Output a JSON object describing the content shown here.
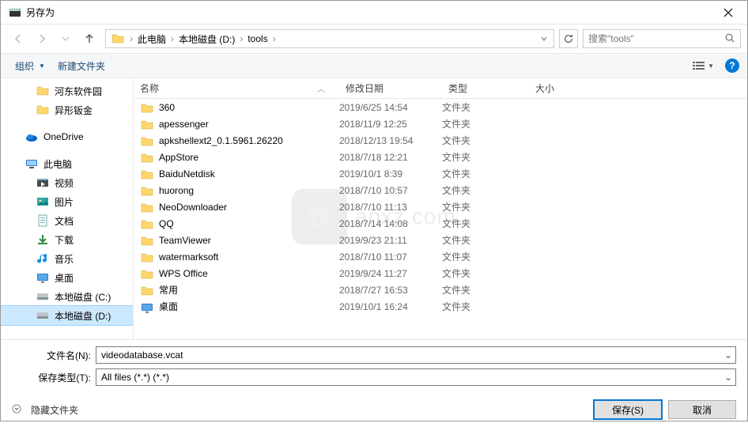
{
  "window": {
    "title": "另存为"
  },
  "nav": {
    "breadcrumbs": [
      "此电脑",
      "本地磁盘 (D:)",
      "tools"
    ],
    "search_placeholder": "搜索\"tools\""
  },
  "toolbar": {
    "organize": "组织",
    "new_folder": "新建文件夹"
  },
  "sidebar": {
    "items": [
      {
        "label": "河东软件园",
        "icon": "folder",
        "lvl": 1
      },
      {
        "label": "异形钣金",
        "icon": "folder",
        "lvl": 1
      },
      {
        "sep": true
      },
      {
        "label": "OneDrive",
        "icon": "onedrive",
        "lvl": 0
      },
      {
        "sep": true
      },
      {
        "label": "此电脑",
        "icon": "pc",
        "lvl": 0
      },
      {
        "label": "视频",
        "icon": "video",
        "lvl": 1
      },
      {
        "label": "图片",
        "icon": "pictures",
        "lvl": 1
      },
      {
        "label": "文档",
        "icon": "documents",
        "lvl": 1
      },
      {
        "label": "下载",
        "icon": "downloads",
        "lvl": 1
      },
      {
        "label": "音乐",
        "icon": "music",
        "lvl": 1
      },
      {
        "label": "桌面",
        "icon": "desktop",
        "lvl": 1
      },
      {
        "label": "本地磁盘 (C:)",
        "icon": "disk",
        "lvl": 1
      },
      {
        "label": "本地磁盘 (D:)",
        "icon": "disk",
        "lvl": 1,
        "selected": true
      }
    ]
  },
  "columns": {
    "name": "名称",
    "date": "修改日期",
    "type": "类型",
    "size": "大小"
  },
  "files": [
    {
      "name": "360",
      "date": "2019/6/25 14:54",
      "type": "文件夹",
      "icon": "folder"
    },
    {
      "name": "apessenger",
      "date": "2018/11/9 12:25",
      "type": "文件夹",
      "icon": "folder"
    },
    {
      "name": "apkshellext2_0.1.5961.26220",
      "date": "2018/12/13 19:54",
      "type": "文件夹",
      "icon": "folder"
    },
    {
      "name": "AppStore",
      "date": "2018/7/18 12:21",
      "type": "文件夹",
      "icon": "folder"
    },
    {
      "name": "BaiduNetdisk",
      "date": "2019/10/1 8:39",
      "type": "文件夹",
      "icon": "folder"
    },
    {
      "name": "huorong",
      "date": "2018/7/10 10:57",
      "type": "文件夹",
      "icon": "folder"
    },
    {
      "name": "NeoDownloader",
      "date": "2018/7/10 11:13",
      "type": "文件夹",
      "icon": "folder"
    },
    {
      "name": "QQ",
      "date": "2018/7/14 14:08",
      "type": "文件夹",
      "icon": "folder"
    },
    {
      "name": "TeamViewer",
      "date": "2019/9/23 21:11",
      "type": "文件夹",
      "icon": "folder"
    },
    {
      "name": "watermarksoft",
      "date": "2018/7/10 11:07",
      "type": "文件夹",
      "icon": "folder"
    },
    {
      "name": "WPS Office",
      "date": "2019/9/24 11:27",
      "type": "文件夹",
      "icon": "folder"
    },
    {
      "name": "常用",
      "date": "2018/7/27 16:53",
      "type": "文件夹",
      "icon": "folder"
    },
    {
      "name": "桌面",
      "date": "2019/10/1 16:24",
      "type": "文件夹",
      "icon": "desktop"
    }
  ],
  "fields": {
    "filename_label": "文件名(N):",
    "filename_value": "videodatabase.vcat",
    "filetype_label": "保存类型(T):",
    "filetype_value": "All files (*.*) (*.*)"
  },
  "footer": {
    "hide_folders": "隐藏文件夹",
    "save": "保存(S)",
    "cancel": "取消"
  },
  "watermark": {
    "text": "anxz.com"
  }
}
